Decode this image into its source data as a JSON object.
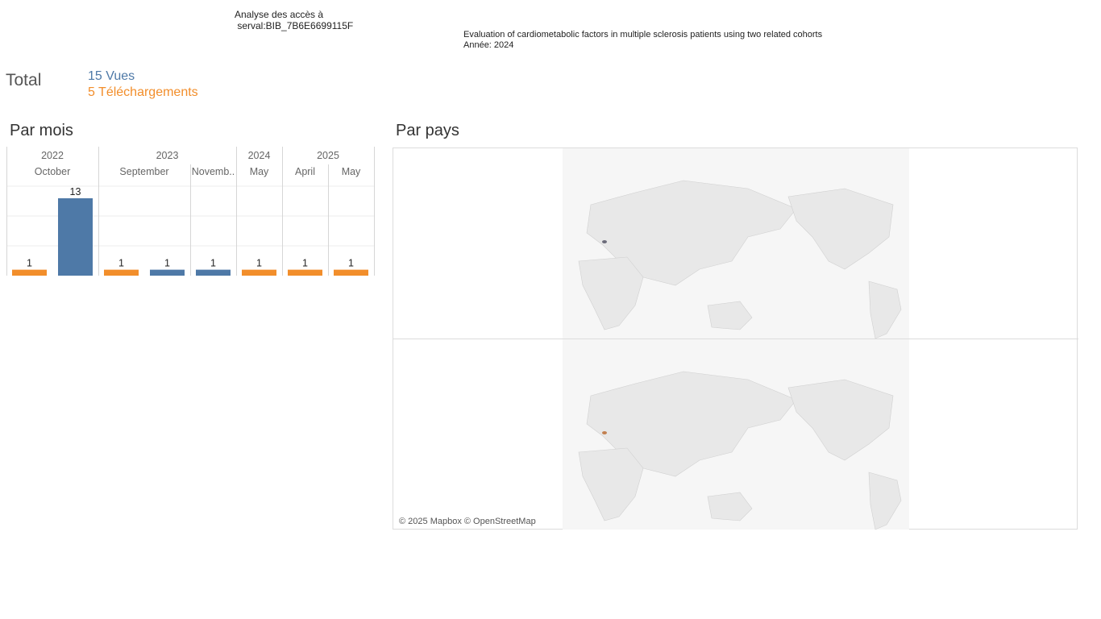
{
  "header": {
    "title": "Analyse des accès à\n serval:BIB_7B6E6699115F"
  },
  "publication": {
    "title": "Evaluation of cardiometabolic factors in multiple sclerosis patients using two related cohorts",
    "year_line": "Année: 2024"
  },
  "totals": {
    "label": "Total",
    "views": "15 Vues",
    "downloads": "5 Téléchargements"
  },
  "sections": {
    "monthly": "Par mois",
    "country": "Par pays"
  },
  "map": {
    "credit": "© 2025 Mapbox © OpenStreetMap"
  },
  "colors": {
    "views": "#4e79a7",
    "downloads": "#f28e2b",
    "land": "#e8e8e8",
    "ocean": "#ffffff",
    "highlight_views": "#6b6b7a",
    "highlight_downloads": "#c28050"
  },
  "chart_data": {
    "type": "bar",
    "title": "Par mois",
    "years": [
      {
        "label": "2022",
        "months": [
          "October"
        ]
      },
      {
        "label": "2023",
        "months": [
          "September",
          "Novemb.."
        ]
      },
      {
        "label": "2024",
        "months": [
          "May"
        ]
      },
      {
        "label": "2025",
        "months": [
          "April",
          "May"
        ]
      }
    ],
    "bars": [
      {
        "year": "2022",
        "month": "October",
        "series": "Téléchargements",
        "value": 1
      },
      {
        "year": "2022",
        "month": "October",
        "series": "Vues",
        "value": 13
      },
      {
        "year": "2023",
        "month": "September",
        "series": "Téléchargements",
        "value": 1
      },
      {
        "year": "2023",
        "month": "September",
        "series": "Vues",
        "value": 1
      },
      {
        "year": "2023",
        "month": "Novemb..",
        "series": "Vues",
        "value": 1
      },
      {
        "year": "2024",
        "month": "May",
        "series": "Téléchargements",
        "value": 1
      },
      {
        "year": "2025",
        "month": "April",
        "series": "Téléchargements",
        "value": 1
      },
      {
        "year": "2025",
        "month": "May",
        "series": "Téléchargements",
        "value": 1
      }
    ],
    "grid": true
  }
}
